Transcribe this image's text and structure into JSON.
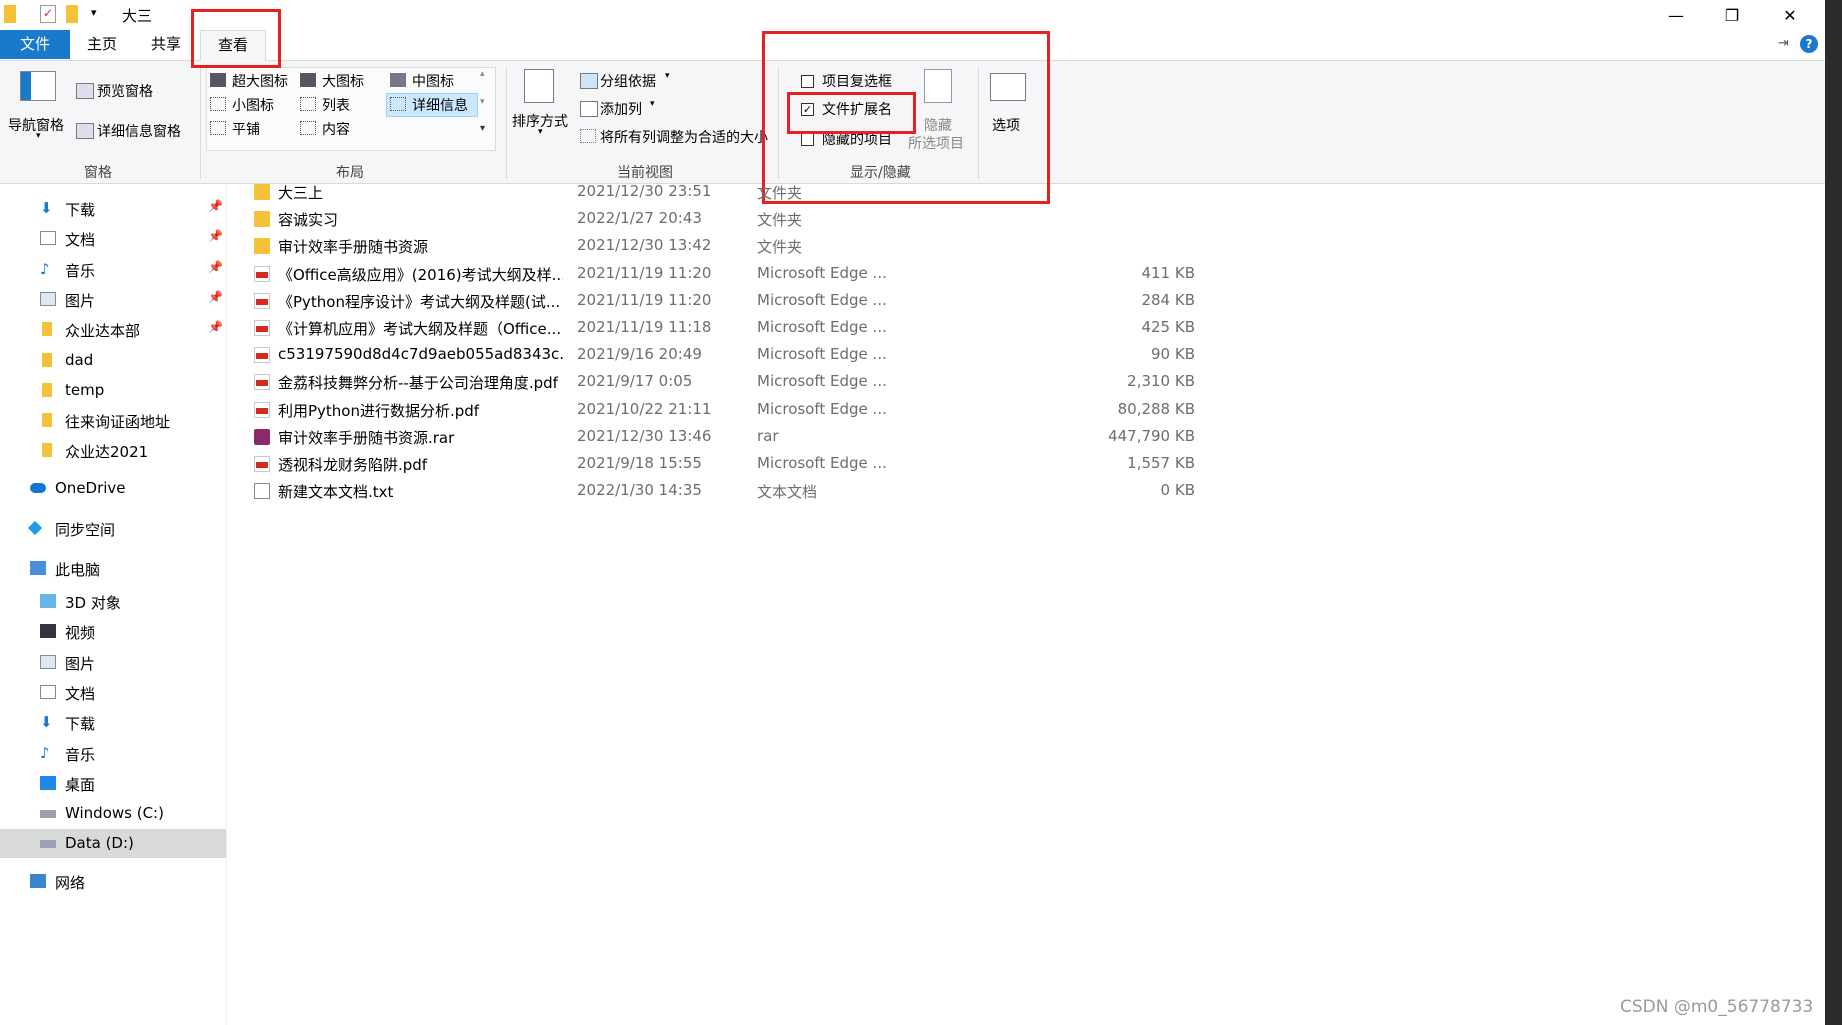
{
  "window": {
    "title": "大三",
    "controls": {
      "minimize": "—",
      "restore": "❐",
      "close": "✕"
    }
  },
  "ribbon_tabs": [
    {
      "label": "文件"
    },
    {
      "label": "主页"
    },
    {
      "label": "共享"
    },
    {
      "label": "查看",
      "active": true
    }
  ],
  "ribbon": {
    "pane_group": {
      "nav_pane": "导航窗格",
      "preview_pane": "预览窗格",
      "details_pane": "详细信息窗格",
      "label": "窗格"
    },
    "layout_group": {
      "extra_large_icons": "超大图标",
      "large_icons": "大图标",
      "medium_icons": "中图标",
      "small_icons": "小图标",
      "list": "列表",
      "details": "详细信息",
      "tiles": "平铺",
      "content": "内容",
      "label": "布局"
    },
    "current_view_group": {
      "sort_by": "排序方式",
      "group_by": "分组依据",
      "add_columns": "添加列",
      "fit_columns": "将所有列调整为合适的大小",
      "label": "当前视图"
    },
    "show_hide_group": {
      "item_checkboxes": {
        "label": "项目复选框",
        "checked": false
      },
      "file_extensions": {
        "label": "文件扩展名",
        "checked": true
      },
      "hidden_items": {
        "label": "隐藏的项目",
        "checked": false
      },
      "hide_selected_line1": "隐藏",
      "hide_selected_line2": "所选项目",
      "label": "显示/隐藏"
    },
    "options": "选项"
  },
  "nav": {
    "quick_access": [
      {
        "label": "下载",
        "icon": "download-icon",
        "pinned": true
      },
      {
        "label": "文档",
        "icon": "document-icon",
        "pinned": true
      },
      {
        "label": "音乐",
        "icon": "music-icon",
        "pinned": true
      },
      {
        "label": "图片",
        "icon": "picture-icon",
        "pinned": true
      },
      {
        "label": "众业达本部",
        "icon": "folder-icon",
        "pinned": true
      },
      {
        "label": "dad",
        "icon": "folder-icon"
      },
      {
        "label": "temp",
        "icon": "folder-icon"
      },
      {
        "label": "往来询证函地址",
        "icon": "folder-icon"
      },
      {
        "label": "众业达2021",
        "icon": "folder-icon"
      }
    ],
    "onedrive": "OneDrive",
    "sync_space": "同步空间",
    "this_pc": "此电脑",
    "pc_items": [
      {
        "label": "3D 对象",
        "icon": "cube-icon"
      },
      {
        "label": "视频",
        "icon": "video-icon"
      },
      {
        "label": "图片",
        "icon": "picture-icon"
      },
      {
        "label": "文档",
        "icon": "document-icon"
      },
      {
        "label": "下载",
        "icon": "download-icon"
      },
      {
        "label": "音乐",
        "icon": "music-icon"
      },
      {
        "label": "桌面",
        "icon": "desktop-icon"
      },
      {
        "label": "Windows (C:)",
        "icon": "drive-icon"
      },
      {
        "label": "Data (D:)",
        "icon": "drive-icon",
        "selected": true
      }
    ],
    "network": "网络",
    "pin_glyph": "📌"
  },
  "files": [
    {
      "name": "大三上",
      "date": "2021/12/30 23:51",
      "type": "文件夹",
      "size": "",
      "kind": "folder"
    },
    {
      "name": "容诚实习",
      "date": "2022/1/27 20:43",
      "type": "文件夹",
      "size": "",
      "kind": "folder"
    },
    {
      "name": "审计效率手册随书资源",
      "date": "2021/12/30 13:42",
      "type": "文件夹",
      "size": "",
      "kind": "folder"
    },
    {
      "name": "《Office高级应用》(2016)考试大纲及样...",
      "date": "2021/11/19 11:20",
      "type": "Microsoft Edge ...",
      "size": "411 KB",
      "kind": "pdf"
    },
    {
      "name": "《Python程序设计》考试大纲及样题(试...",
      "date": "2021/11/19 11:20",
      "type": "Microsoft Edge ...",
      "size": "284 KB",
      "kind": "pdf"
    },
    {
      "name": "《计算机应用》考试大纲及样题（Office...",
      "date": "2021/11/19 11:18",
      "type": "Microsoft Edge ...",
      "size": "425 KB",
      "kind": "pdf"
    },
    {
      "name": "c53197590d8d4c7d9aeb055ad8343c...",
      "date": "2021/9/16 20:49",
      "type": "Microsoft Edge ...",
      "size": "90 KB",
      "kind": "pdf"
    },
    {
      "name": "金荔科技舞弊分析--基于公司治理角度.pdf",
      "date": "2021/9/17 0:05",
      "type": "Microsoft Edge ...",
      "size": "2,310 KB",
      "kind": "pdf"
    },
    {
      "name": "利用Python进行数据分析.pdf",
      "date": "2021/10/22 21:11",
      "type": "Microsoft Edge ...",
      "size": "80,288 KB",
      "kind": "pdf"
    },
    {
      "name": "审计效率手册随书资源.rar",
      "date": "2021/12/30 13:46",
      "type": "rar",
      "size": "447,790 KB",
      "kind": "rar"
    },
    {
      "name": "透视科龙财务陷阱.pdf",
      "date": "2021/9/18 15:55",
      "type": "Microsoft Edge ...",
      "size": "1,557 KB",
      "kind": "pdf"
    },
    {
      "name": "新建文本文档.txt",
      "date": "2022/1/30 14:35",
      "type": "文本文档",
      "size": "0 KB",
      "kind": "txt"
    }
  ],
  "watermark": "CSDN @m0_56778733",
  "colors": {
    "accent": "#1979ca",
    "highlight_box": "#e8201f",
    "folder": "#f3c13a"
  }
}
